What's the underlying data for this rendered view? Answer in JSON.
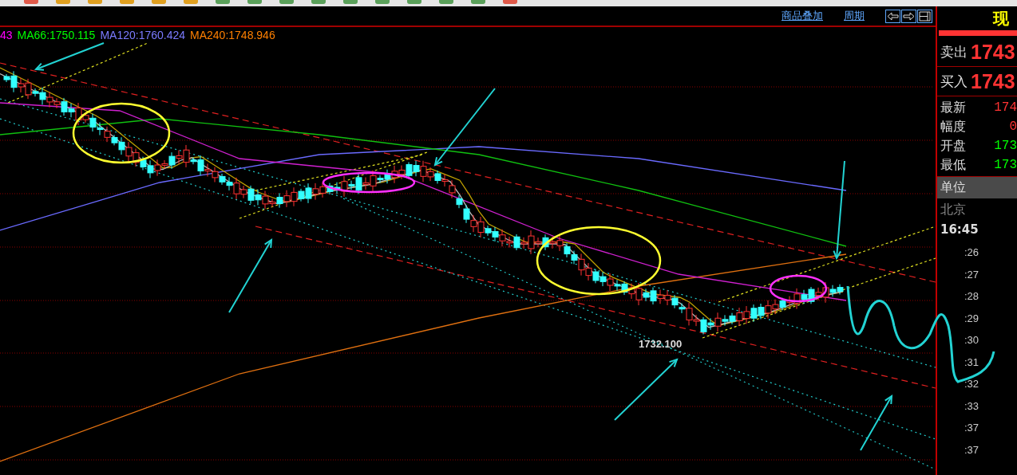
{
  "header_links": [
    "商品叠加",
    "周期"
  ],
  "legend": [
    {
      "text": "43",
      "color": "#ff00ff"
    },
    {
      "text": "MA66:1750.115",
      "color": "#00ff00"
    },
    {
      "text": "MA120:1760.424",
      "color": "#7b7bff"
    },
    {
      "text": "MA240:1748.946",
      "color": "#ff8000"
    }
  ],
  "price_label": "1732.100",
  "quote_panel": {
    "title": "现",
    "bid_ask": [
      {
        "label": "卖出",
        "value": "1743"
      },
      {
        "label": "买入",
        "value": "1743"
      }
    ],
    "stats": [
      {
        "label": "最新",
        "value": "174",
        "color": "#ff3333"
      },
      {
        "label": "幅度",
        "value": "0",
        "color": "#ff3333"
      },
      {
        "label": "开盘",
        "value": "173",
        "color": "#00ff00"
      },
      {
        "label": "最低",
        "value": "173",
        "color": "#00ff00"
      }
    ],
    "unit_label": "单位",
    "location": "北京",
    "time": "16:45",
    "tick_times": [
      ":26",
      ":27",
      ":28",
      ":29",
      ":30",
      ":31",
      ":32",
      ":33",
      ":37",
      ":37"
    ]
  }
}
